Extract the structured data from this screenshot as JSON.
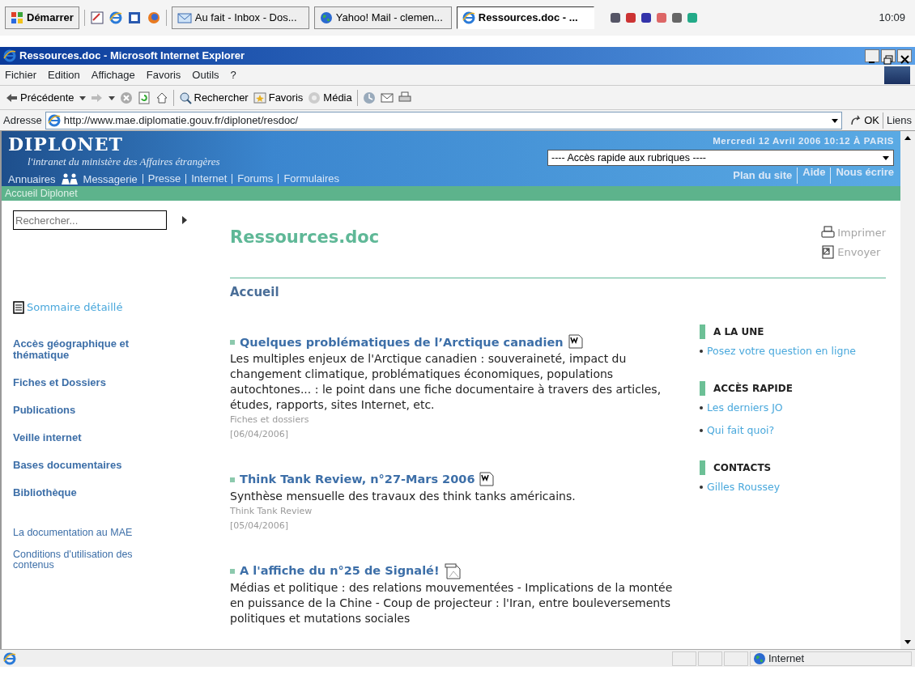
{
  "taskbar": {
    "start": "Démarrer",
    "tasks": [
      {
        "label": "Au fait - Inbox - Dos...",
        "kind": "mail",
        "selected": false
      },
      {
        "label": "Yahoo! Mail - clemen...",
        "kind": "globe",
        "selected": false
      },
      {
        "label": "Ressources.doc - ...",
        "kind": "ie",
        "selected": true
      }
    ],
    "clock": "10:09"
  },
  "window": {
    "title": "Ressources.doc - Microsoft Internet Explorer"
  },
  "menu": [
    "Fichier",
    "Edition",
    "Affichage",
    "Favoris",
    "Outils",
    "?"
  ],
  "toolbar": [
    {
      "kind": "back",
      "label": "Précédente"
    },
    {
      "kind": "forward"
    },
    {
      "kind": "stop"
    },
    {
      "kind": "refresh"
    },
    {
      "kind": "home"
    },
    {
      "kind": "search",
      "label": "Rechercher"
    },
    {
      "kind": "favorites",
      "label": "Favoris"
    },
    {
      "kind": "media",
      "label": "Média"
    },
    {
      "kind": "history"
    },
    {
      "kind": "mail"
    },
    {
      "kind": "print"
    }
  ],
  "address": {
    "label": "Adresse",
    "url": "http://www.mae.diplomatie.gouv.fr/diplonet/resdoc/",
    "go": "OK",
    "links": "Liens"
  },
  "page": {
    "header": {
      "logo": "DIPLONET",
      "tagline": "l'intranet du ministère des Affaires étrangères",
      "date": "Mercredi 12 Avril 2006 10:12 À PARIS",
      "quick_access": "---- Accès rapide aux rubriques ----",
      "nav": [
        "Annuaires",
        "Messagerie",
        "Presse",
        "Internet",
        "Forums",
        "Formulaires"
      ],
      "nav_right": [
        "Plan du site",
        "Aide",
        "Nous écrire"
      ],
      "breadcrumb": "Accueil Diplonet"
    },
    "sidebar": {
      "search_placeholder": "Rechercher...",
      "summary": "Sommaire détaillé",
      "main_links": [
        "Accès géographique et thématique",
        "Fiches et Dossiers",
        "Publications",
        "Veille internet",
        "Bases documentaires",
        "Bibliothèque"
      ],
      "other_links": [
        "La documentation au MAE",
        "Conditions d'utilisation des contenus"
      ]
    },
    "title": "Ressources.doc",
    "actions": [
      {
        "kind": "print",
        "label": "Imprimer"
      },
      {
        "kind": "send",
        "label": "Envoyer"
      }
    ],
    "section": "Accueil",
    "articles": [
      {
        "title": "Quelques problématiques de l’Arctique canadien",
        "kind": "word",
        "text": "Les multiples enjeux de l'Arctique canadien : souveraineté, impact du changement climatique, problématiques économiques, populations autochtones... : le point dans une fiche documentaire à travers des articles, études, rapports, sites Internet, etc.",
        "category": "Fiches et dossiers",
        "date": "[06/04/2006]"
      },
      {
        "title": "Think Tank Review, n°27-Mars 2006",
        "kind": "word",
        "text": "Synthèse mensuelle des travaux des think tanks américains.",
        "category": "Think Tank Review",
        "date": "[05/04/2006]"
      },
      {
        "title": "A l'affiche du n°25 de Signalé!",
        "kind": "pdf",
        "text": "Médias et politique : des relations mouvementées - Implications de la montée en puissance de la Chine - Coup de projecteur : l'Iran, entre bouleversements politiques et mutations sociales"
      }
    ],
    "blocks": [
      {
        "heading": "A LA UNE",
        "links": [
          "Posez votre question en ligne"
        ]
      },
      {
        "heading": "ACCÈS RAPIDE",
        "links": [
          "Les derniers JO",
          "Qui fait quoi?"
        ]
      },
      {
        "heading": "CONTACTS",
        "links": [
          "Gilles Roussey"
        ]
      }
    ]
  },
  "status_bar": {
    "zone": "Internet"
  }
}
